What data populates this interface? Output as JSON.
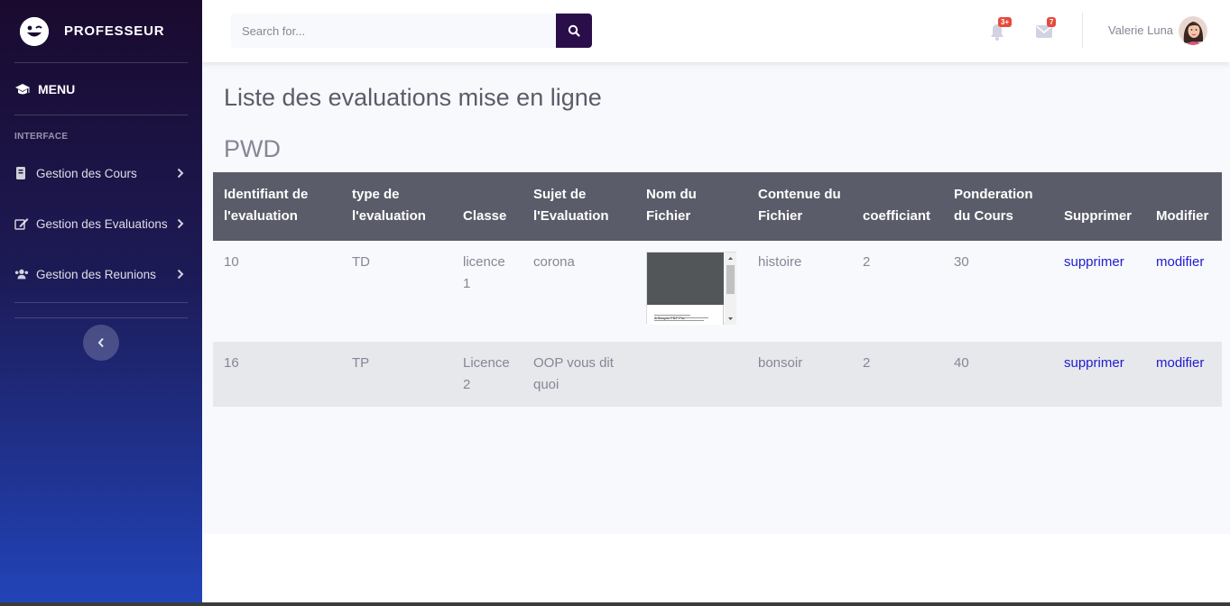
{
  "brand": {
    "name": "PROFESSEUR"
  },
  "sidebar": {
    "menu_label": "MENU",
    "heading": "INTERFACE",
    "items": [
      {
        "label": "Gestion des Cours",
        "icon": "book-icon"
      },
      {
        "label": "Gestion des Evaluations",
        "icon": "edit-icon"
      },
      {
        "label": "Gestion des Reunions",
        "icon": "users-icon"
      }
    ]
  },
  "topbar": {
    "search_placeholder": "Search for...",
    "alerts_badge": "3+",
    "messages_badge": "7",
    "user_name": "Valerie Luna"
  },
  "main": {
    "title": "Liste des evaluations mise en ligne",
    "subtitle": "PWD",
    "table": {
      "headers": [
        "Identifiant de l'evaluation",
        "type de l'evaluation",
        "Classe",
        "Sujet de l'Evaluation",
        "Nom du Fichier",
        "Contenue du Fichier",
        "coefficiant",
        "Ponderation du Cours",
        "Supprimer",
        "Modifier"
      ],
      "rows": [
        {
          "id": "10",
          "type": "TD",
          "classe": "licence 1",
          "sujet": "corona",
          "fichier_preview_title": "A Simple PDF File",
          "contenu": "histoire",
          "coef": "2",
          "ponderation": "30",
          "delete": "supprimer",
          "edit": "modifier"
        },
        {
          "id": "16",
          "type": "TP",
          "classe": "Licence 2",
          "sujet": "OOP vous dit quoi",
          "contenu": "bonsoir",
          "coef": "2",
          "ponderation": "40",
          "delete": "supprimer",
          "edit": "modifier"
        }
      ]
    }
  },
  "colors": {
    "sidebar_top": "#1a0a2e",
    "sidebar_bottom": "#2243b8",
    "table_header": "#5a5c69",
    "link": "#1d1bd1",
    "search_button": "#2a0e4a",
    "badge": "#e74a3b"
  }
}
